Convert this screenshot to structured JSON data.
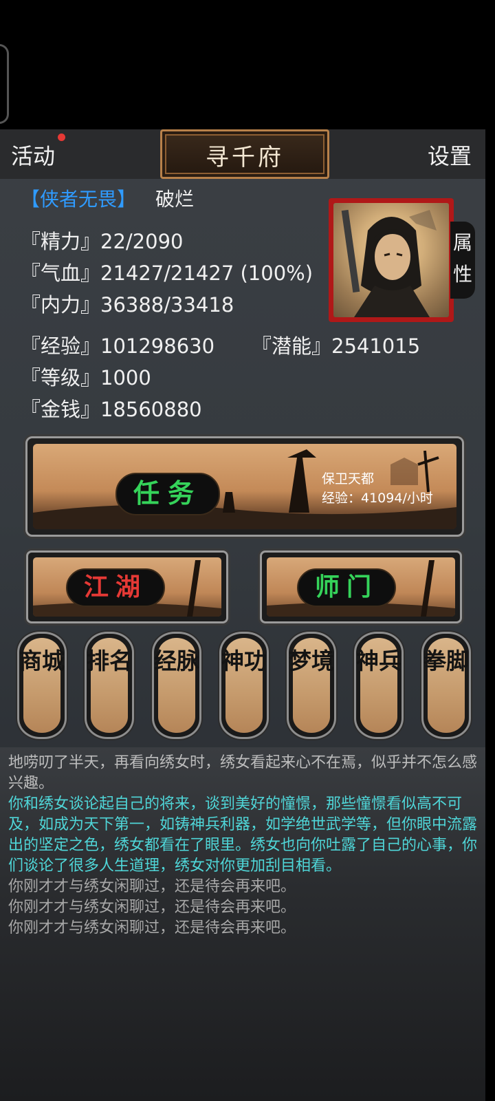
{
  "header": {
    "activity_label": "活动",
    "title": "寻千府",
    "settings_label": "设置"
  },
  "hero": {
    "title": "【侠者无畏】",
    "rank": "破烂",
    "attr_tab_label": "属性"
  },
  "stats": {
    "energy": "『精力』22/2090",
    "hp": "『气血』21427/21427 (100%)",
    "mp": "『内力』36388/33418",
    "exp": "『经验』101298630",
    "potential": "『潜能』2541015",
    "level": "『等级』1000",
    "money": "『金钱』18560880"
  },
  "task": {
    "label": "任务",
    "name": "保卫天都",
    "exp_rate": "经验：41094/小时"
  },
  "buttons": {
    "jianghu": "江湖",
    "shimen": "师门"
  },
  "tiles": [
    {
      "label": "商城"
    },
    {
      "label": "排名"
    },
    {
      "label": "经脉"
    },
    {
      "label": "神功"
    },
    {
      "label": "梦境"
    },
    {
      "label": "神兵"
    },
    {
      "label": "拳脚"
    }
  ],
  "log": [
    {
      "text": "地唠叨了半天，再看向绣女时，绣女看起来心不在焉，似乎并不怎么感兴趣。",
      "color": "gray"
    },
    {
      "text": "你和绣女谈论起自己的将来，谈到美好的憧憬，那些憧憬看似高不可及，如成为天下第一，如铸神兵利器，如学绝世武学等，但你眼中流露出的坚定之色，绣女都看在了眼里。绣女也向你吐露了自己的心事，你们谈论了很多人生道理，绣女对你更加刮目相看。",
      "color": "cyan"
    },
    {
      "text": "你刚才才与绣女闲聊过，还是待会再来吧。",
      "color": "dim"
    },
    {
      "text": "你刚才才与绣女闲聊过，还是待会再来吧。",
      "color": "dim"
    },
    {
      "text": "你刚才才与绣女闲聊过，还是待会再来吧。",
      "color": "dim"
    }
  ],
  "colors": {
    "title_blue": "#2f9bff",
    "task_green": "#35d35a",
    "jianghu_red": "#e53935",
    "log_cyan": "#4fd6d8",
    "notify_dot": "#e53935"
  }
}
